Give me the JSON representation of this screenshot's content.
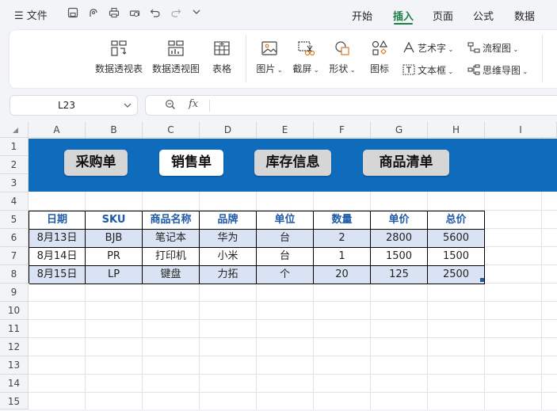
{
  "topbar": {
    "menu_label": "文件",
    "tabs": [
      {
        "label": "开始",
        "active": false
      },
      {
        "label": "插入",
        "active": true
      },
      {
        "label": "页面",
        "active": false
      },
      {
        "label": "公式",
        "active": false
      },
      {
        "label": "数据",
        "active": false
      }
    ]
  },
  "ribbon": {
    "pivot_table": "数据透视表",
    "pivot_chart": "数据透视图",
    "table": "表格",
    "picture": "图片",
    "screenshot": "截屏",
    "shape": "形状",
    "icon": "图标",
    "art_text": "艺术字",
    "flowchart": "流程图",
    "textbox": "文本框",
    "mindmap": "思维导图"
  },
  "formula_bar": {
    "cell_ref": "L23",
    "fx_label": "fx",
    "formula": ""
  },
  "sheet": {
    "columns": [
      "A",
      "B",
      "C",
      "D",
      "E",
      "F",
      "G",
      "H",
      "I"
    ],
    "rows": [
      "1",
      "2",
      "3",
      "4",
      "5",
      "6",
      "7",
      "8",
      "9",
      "10",
      "11",
      "12",
      "13",
      "14",
      "15"
    ],
    "banner_buttons": [
      {
        "label": "采购单",
        "active": false
      },
      {
        "label": "销售单",
        "active": true
      },
      {
        "label": "库存信息",
        "active": false
      },
      {
        "label": "商品清单",
        "active": false
      }
    ],
    "banner_color": "#0f6cbd",
    "table": {
      "headers": [
        "日期",
        "SKU",
        "商品名称",
        "品牌",
        "单位",
        "数量",
        "单价",
        "总价"
      ],
      "rows": [
        [
          "8月13日",
          "BJB",
          "笔记本",
          "华为",
          "台",
          "2",
          "2800",
          "5600"
        ],
        [
          "8月14日",
          "PR",
          "打印机",
          "小米",
          "台",
          "1",
          "1500",
          "1500"
        ],
        [
          "8月15日",
          "LP",
          "键盘",
          "力拓",
          "个",
          "20",
          "125",
          "2500"
        ]
      ]
    }
  }
}
